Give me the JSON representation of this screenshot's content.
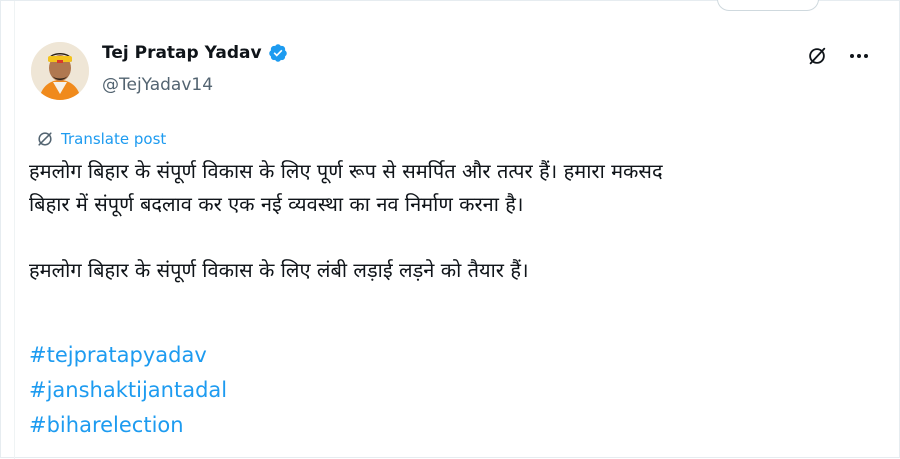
{
  "post": {
    "author": {
      "name": "Tej Pratap Yadav",
      "handle": "@TejYadav14",
      "verified": true,
      "verified_color": "#1d9bf0"
    },
    "actions": {
      "grok_icon": "slashed-circle-icon",
      "more_icon": "more-dots-icon"
    },
    "translate_label": "Translate post",
    "text_lines": [
      "हमलोग बिहार के संपूर्ण विकास के लिए पूर्ण रूप से समर्पित और तत्पर हैं। हमारा मकसद",
      "बिहार में संपूर्ण बदलाव कर एक नई व्यवस्था का नव निर्माण करना है।",
      "हमलोग बिहार के संपूर्ण विकास के लिए लंबी लड़ाई लड़ने को तैयार हैं।"
    ],
    "hashtags": [
      "#tejpratapyadav",
      "#janshaktijantadal",
      "#biharelection"
    ]
  },
  "colors": {
    "text": "#0f1419",
    "secondary": "#536471",
    "link": "#1d9bf0"
  }
}
